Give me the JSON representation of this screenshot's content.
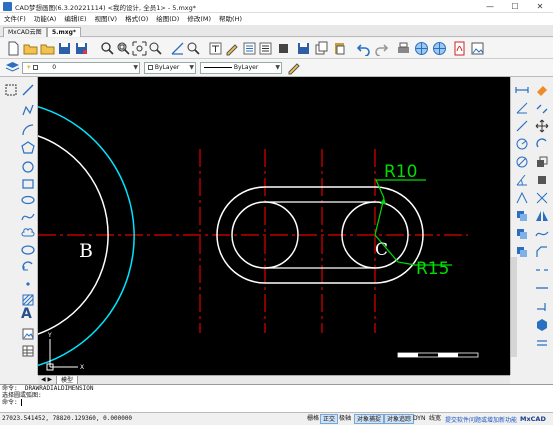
{
  "window": {
    "title": "CAD梦想画图(6.3.20221114) <我的设计, 全员1> - 5.mxg*",
    "minimize": "—",
    "maximize": "☐",
    "close": "✕"
  },
  "menu": [
    "文件(F)",
    "功能(A)",
    "编辑(E)",
    "视图(V)",
    "格式(O)",
    "绘图(D)",
    "修改(M)",
    "帮助(H)"
  ],
  "tabs": [
    "MxCAD云图",
    "5.mxg*"
  ],
  "layer": {
    "name": "0",
    "color": "ByLayer",
    "linetype": "ByLayer"
  },
  "colors": {
    "dimension": "#00dd00",
    "centerline": "#e00000",
    "geometry": "#ffffff",
    "arc": "#00e5ff",
    "canvas": "#000000"
  },
  "drawing": {
    "point_b": "B",
    "point_c": "C",
    "dim_r10": "R10",
    "dim_r15": "R15",
    "ucs_y": "Y",
    "ucs_x": "X"
  },
  "model_tab": "模型",
  "command": {
    "line1": "命令: _DRAWRADIALDIMENSION",
    "line2": "选择圆或弧图:",
    "prompt": "命令:"
  },
  "status": {
    "coords": "27023.541452, 78820.129360, 0.000000",
    "buttons": [
      "栅格",
      "正交",
      "极轴",
      "对象捕捉",
      "对象追踪",
      "DYN",
      "线宽"
    ],
    "active": [
      "正交",
      "对象捕捉",
      "对象追踪"
    ],
    "promo": "提交软件问题或增加新功能",
    "brand": "MxCAD"
  }
}
